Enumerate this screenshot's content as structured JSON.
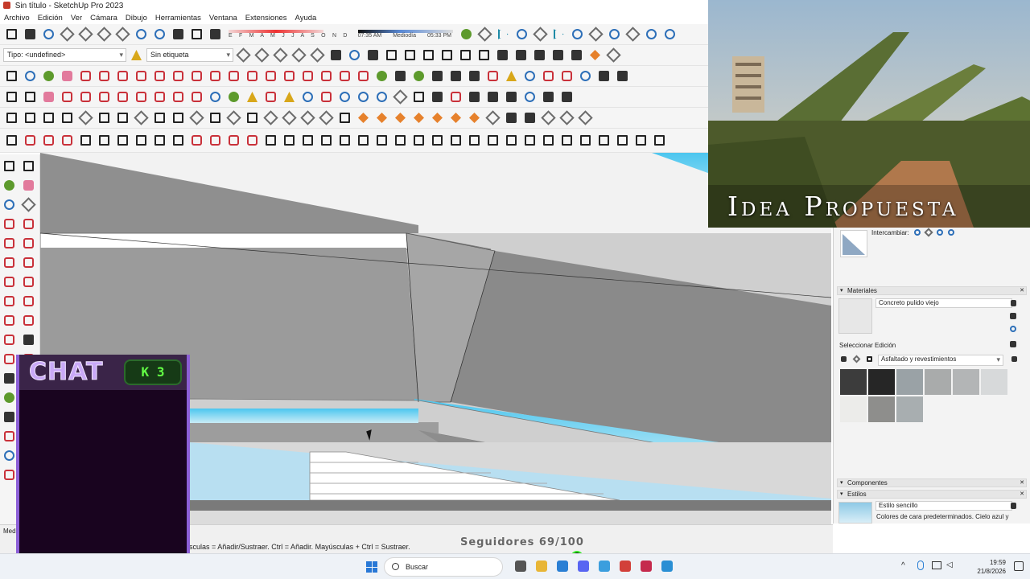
{
  "window": {
    "title": "Sin título - SketchUp Pro 2023"
  },
  "menu": [
    "Archivo",
    "Edición",
    "Ver",
    "Cámara",
    "Dibujo",
    "Herramientas",
    "Ventana",
    "Extensiones",
    "Ayuda"
  ],
  "toolbar": {
    "tag_type": "Tipo: <undefined>",
    "tag_select": "Sin etiqueta",
    "months": "E F M A M J J A S O N D",
    "time_start": "07:35 AM",
    "time_mid": "Mediodía",
    "time_end": "05:33 PM"
  },
  "right_panel": {
    "swap_label": "Intercambiar:",
    "materials_header": "Materiales",
    "material_name": "Concreto pulido viejo",
    "select_tab": "Seleccionar",
    "edit_tab": "Edición",
    "library": "Asfaltado y revestimientos",
    "components_header": "Componentes",
    "styles_header": "Estilos",
    "style_name": "Estilo sencillo",
    "style_desc": "Colores de cara predeterminados. Cielo azul y",
    "swatch_colors": [
      "#3c3c3c",
      "#262626",
      "#9aa2a6",
      "#a9abab",
      "#b3b5b6",
      "#d7d9da",
      "#ececea",
      "#8e8e8c",
      "#a8aeb0"
    ]
  },
  "status": {
    "hint": "sculas = Añadir/Sustraer. Ctrl = Añadir. Mayúsculas + Ctrl = Sustraer.",
    "measure": "Medi"
  },
  "overlay": {
    "followers": "Seguidores 69/100",
    "followers_progress": 0.69,
    "chat_title": "CHAT",
    "chat_badge": "K 3",
    "photo_title": "Idea Propuesta"
  },
  "taskbar": {
    "search_placeholder": "Buscar",
    "time": "19:59",
    "date": "21/8/2026"
  }
}
